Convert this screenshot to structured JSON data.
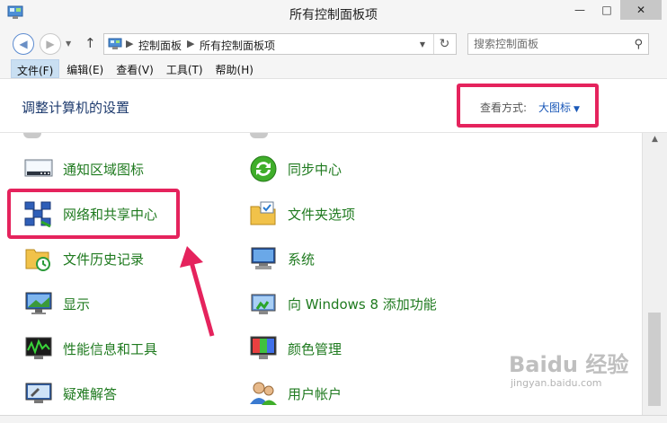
{
  "window": {
    "title": "所有控制面板项",
    "minimize_glyph": "—",
    "maximize_glyph": "□",
    "close_glyph": "✕"
  },
  "addressbar": {
    "breadcrumbs": [
      "控制面板",
      "所有控制面板项"
    ],
    "separator": "▶",
    "search_placeholder": "搜索控制面板"
  },
  "menubar": {
    "items": [
      "文件(F)",
      "编辑(E)",
      "查看(V)",
      "工具(T)",
      "帮助(H)"
    ],
    "active_index": 0
  },
  "header": {
    "title": "调整计算机的设置",
    "view_label": "查看方式:",
    "view_value": "大图标"
  },
  "items": {
    "notification_icons": "通知区域图标",
    "sync_center": "同步中心",
    "network_sharing": "网络和共享中心",
    "folder_options": "文件夹选项",
    "file_history": "文件历史记录",
    "system": "系统",
    "display": "显示",
    "add_features": "向 Windows 8 添加功能",
    "performance": "性能信息和工具",
    "color_management": "颜色管理",
    "troubleshooting": "疑难解答",
    "user_accounts": "用户帐户"
  },
  "colors": {
    "item_text": "#1f7a1f",
    "highlight": "#e5235d",
    "link_blue": "#1a58b8"
  },
  "watermark": {
    "logo": "Baidu 经验",
    "sub": "jingyan.baidu.com"
  }
}
